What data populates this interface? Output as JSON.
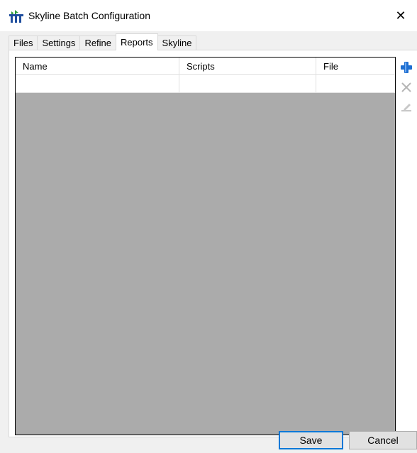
{
  "window": {
    "title": "Skyline Batch Configuration",
    "close_glyph": "✕"
  },
  "tabs": [
    {
      "label": "Files",
      "active": false
    },
    {
      "label": "Settings",
      "active": false
    },
    {
      "label": "Refine",
      "active": false
    },
    {
      "label": "Reports",
      "active": true
    },
    {
      "label": "Skyline",
      "active": false
    }
  ],
  "reports_grid": {
    "columns": [
      "Name",
      "Scripts",
      "File"
    ],
    "rows": [
      [
        "",
        "",
        ""
      ]
    ]
  },
  "side_buttons": {
    "add_icon": "plus-icon",
    "delete_icon": "delete-icon",
    "edit_icon": "edit-icon"
  },
  "footer": {
    "save_label": "Save",
    "cancel_label": "Cancel"
  },
  "colors": {
    "accent": "#0078d7",
    "grid_background": "#ababab",
    "add_icon": "#1e6fd1"
  }
}
